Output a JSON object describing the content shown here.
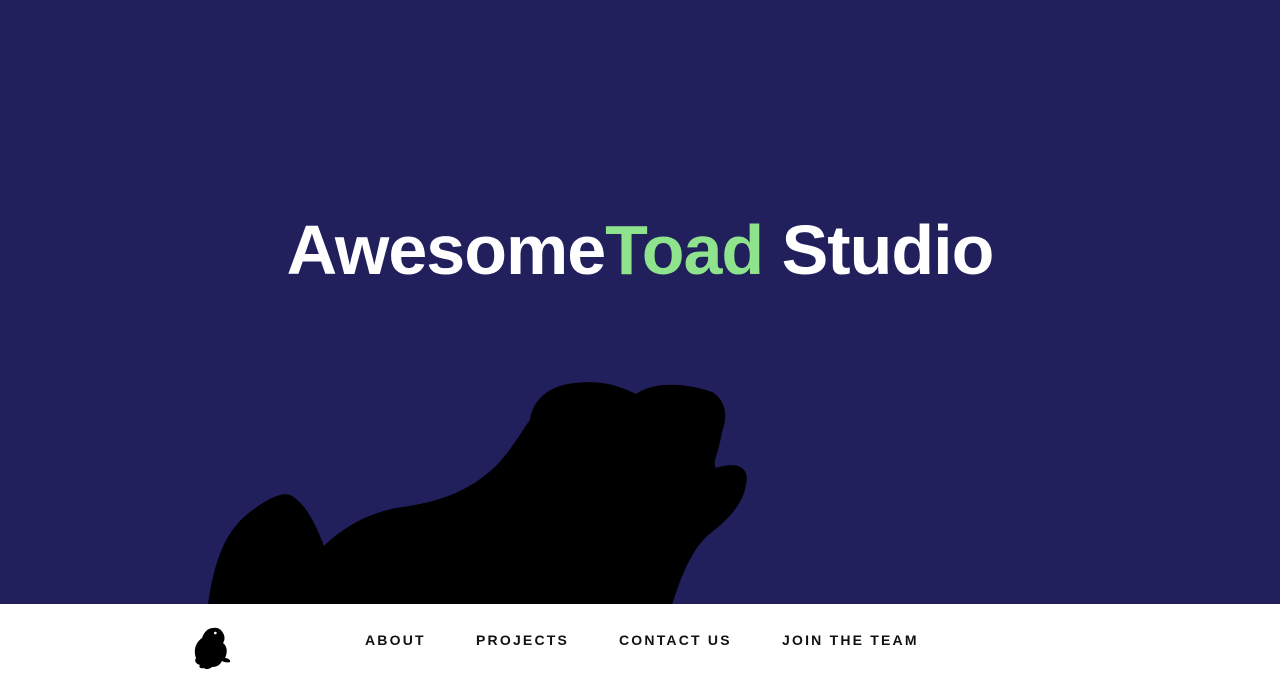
{
  "colors": {
    "hero_background": "#211f5c",
    "title_text": "#ffffff",
    "title_accent": "#8ee38c",
    "silhouette": "#000000",
    "nav_background": "#ffffff",
    "nav_text": "#111111"
  },
  "hero": {
    "title_part1": "Awesome",
    "title_accent": "Toad",
    "title_part2": " Studio",
    "illustration_icon": "toad-silhouette-icon"
  },
  "nav": {
    "logo_icon": "toad-logo-icon",
    "links": [
      {
        "label": "ABOUT"
      },
      {
        "label": "PROJECTS"
      },
      {
        "label": "CONTACT US"
      },
      {
        "label": "JOIN THE TEAM"
      }
    ]
  }
}
